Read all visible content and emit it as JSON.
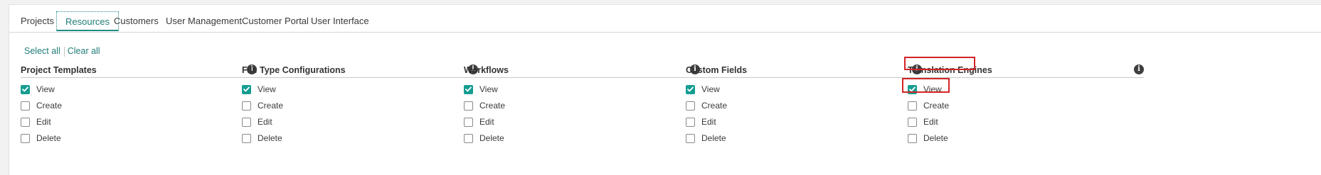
{
  "tabs": [
    {
      "label": "Projects",
      "active": false
    },
    {
      "label": "Resources",
      "active": true
    },
    {
      "label": "Customers",
      "active": false
    },
    {
      "label": "User Management",
      "active": false
    },
    {
      "label": "Customer Portal",
      "active": false
    },
    {
      "label": "User Interface",
      "active": false
    }
  ],
  "links": {
    "select_all": "Select all",
    "clear_all": "Clear all"
  },
  "groups": [
    {
      "title": "Project Templates",
      "options": [
        {
          "label": "View",
          "checked": true
        },
        {
          "label": "Create",
          "checked": false
        },
        {
          "label": "Edit",
          "checked": false
        },
        {
          "label": "Delete",
          "checked": false
        }
      ]
    },
    {
      "title": "File Type Configurations",
      "options": [
        {
          "label": "View",
          "checked": true
        },
        {
          "label": "Create",
          "checked": false
        },
        {
          "label": "Edit",
          "checked": false
        },
        {
          "label": "Delete",
          "checked": false
        }
      ]
    },
    {
      "title": "Workflows",
      "options": [
        {
          "label": "View",
          "checked": true
        },
        {
          "label": "Create",
          "checked": false
        },
        {
          "label": "Edit",
          "checked": false
        },
        {
          "label": "Delete",
          "checked": false
        }
      ]
    },
    {
      "title": "Custom Fields",
      "options": [
        {
          "label": "View",
          "checked": true
        },
        {
          "label": "Create",
          "checked": false
        },
        {
          "label": "Edit",
          "checked": false
        },
        {
          "label": "Delete",
          "checked": false
        }
      ]
    },
    {
      "title": "Translation Engines",
      "options": [
        {
          "label": "View",
          "checked": true
        },
        {
          "label": "Create",
          "checked": false
        },
        {
          "label": "Edit",
          "checked": false
        },
        {
          "label": "Delete",
          "checked": false
        }
      ]
    }
  ],
  "icons": {
    "info": "info-circle-icon",
    "check": "checkmark-icon"
  },
  "colors": {
    "accent": "#1f7c76",
    "checkbox_checked": "#169d92",
    "highlight": "#d42426"
  }
}
